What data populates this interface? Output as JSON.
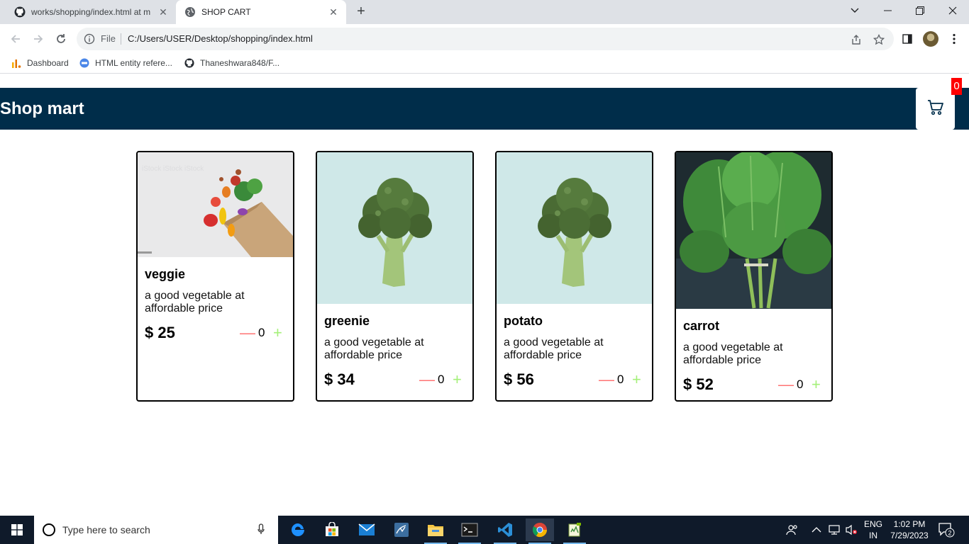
{
  "browser": {
    "tabs": [
      {
        "title": "works/shopping/index.html at m",
        "icon": "github-icon"
      },
      {
        "title": "SHOP CART",
        "icon": "globe-icon"
      }
    ],
    "omnibox": {
      "scheme_label": "File",
      "url": "C:/Users/USER/Desktop/shopping/index.html"
    },
    "bookmarks": [
      {
        "label": "Dashboard",
        "icon": "analytics-icon"
      },
      {
        "label": "HTML entity refere...",
        "icon": "site-icon"
      },
      {
        "label": "Thaneshwara848/F...",
        "icon": "github-icon"
      }
    ]
  },
  "header": {
    "brand": "Shop mart",
    "cart_count": "0",
    "bg_color": "#002d4a",
    "badge_color": "#ff0000"
  },
  "products": [
    {
      "name": "veggie",
      "description": "a good vegetable at affordable price",
      "price": "$ 25",
      "quantity": "0",
      "image": "groceries-bag-image"
    },
    {
      "name": "greenie",
      "description": "a good vegetable at affordable price",
      "price": "$ 34",
      "quantity": "0",
      "image": "broccoli-image"
    },
    {
      "name": "potato",
      "description": "a good vegetable at affordable price",
      "price": "$ 56",
      "quantity": "0",
      "image": "broccoli-image"
    },
    {
      "name": "carrot",
      "description": "a good vegetable at affordable price",
      "price": "$ 52",
      "quantity": "0",
      "image": "spinach-image"
    }
  ],
  "controls": {
    "minus": "—",
    "plus": "+",
    "minus_color": "#ff7373",
    "plus_color": "#a5f07a"
  },
  "taskbar": {
    "search_placeholder": "Type here to search",
    "lang_line1": "ENG",
    "lang_line2": "IN",
    "time": "1:02 PM",
    "date": "7/29/2023",
    "notification_count": "2"
  }
}
